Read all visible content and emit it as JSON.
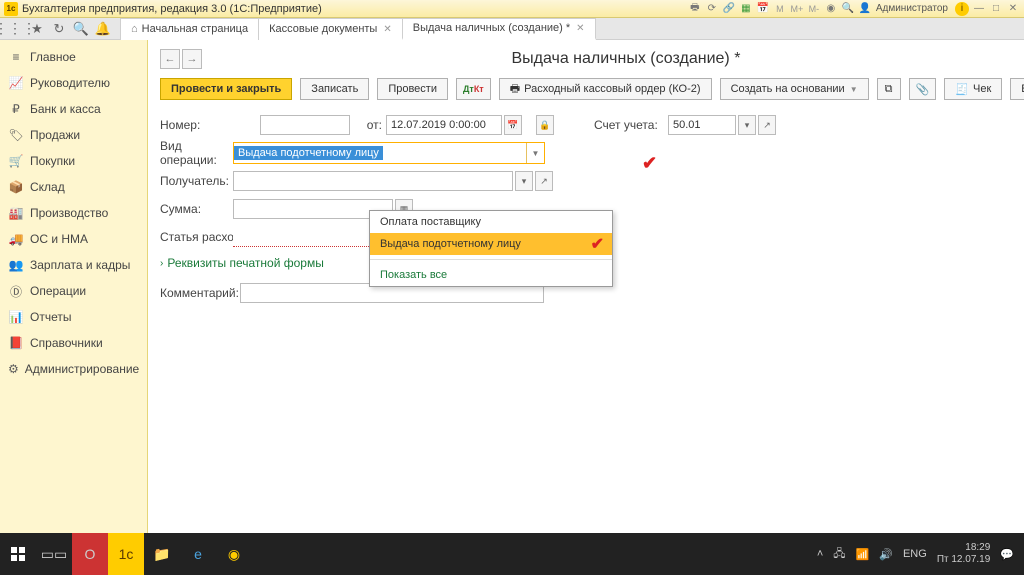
{
  "window": {
    "app_title": "Бухгалтерия предприятия, редакция 3.0  (1С:Предприятие)",
    "user_label": "Администратор"
  },
  "top_tabs": {
    "start": "Начальная страница",
    "t1": "Кассовые документы",
    "t2": "Выдача наличных (создание) *"
  },
  "sidebar": {
    "items": [
      {
        "label": "Главное"
      },
      {
        "label": "Руководителю"
      },
      {
        "label": "Банк и касса"
      },
      {
        "label": "Продажи"
      },
      {
        "label": "Покупки"
      },
      {
        "label": "Склад"
      },
      {
        "label": "Производство"
      },
      {
        "label": "ОС и НМА"
      },
      {
        "label": "Зарплата и кадры"
      },
      {
        "label": "Операции"
      },
      {
        "label": "Отчеты"
      },
      {
        "label": "Справочники"
      },
      {
        "label": "Администрирование"
      }
    ]
  },
  "page": {
    "title": "Выдача наличных (создание) *",
    "btn_post_close": "Провести и закрыть",
    "btn_save": "Записать",
    "btn_post": "Провести",
    "btn_rko": "Расходный кассовый ордер (КО-2)",
    "btn_create_based": "Создать на основании",
    "btn_check": "Чек",
    "btn_more": "Еще"
  },
  "form": {
    "number_label": "Номер:",
    "from_label": "от:",
    "date_value": "12.07.2019  0:00:00",
    "account_label": "Счет учета:",
    "account_value": "50.01",
    "optype_label": "Вид операции:",
    "optype_value": "Выдача подотчетному лицу",
    "recipient_label": "Получатель:",
    "sum_label": "Сумма:",
    "expense_label": "Статья расходов:",
    "print_req": "Реквизиты печатной формы",
    "comment_label": "Комментарий:"
  },
  "dropdown": {
    "opt1": "Оплата поставщику",
    "opt2": "Выдача подотчетному лицу",
    "show_all": "Показать все"
  },
  "taskbar": {
    "lang": "ENG",
    "time": "18:29",
    "date": "Пт 12.07.19"
  }
}
